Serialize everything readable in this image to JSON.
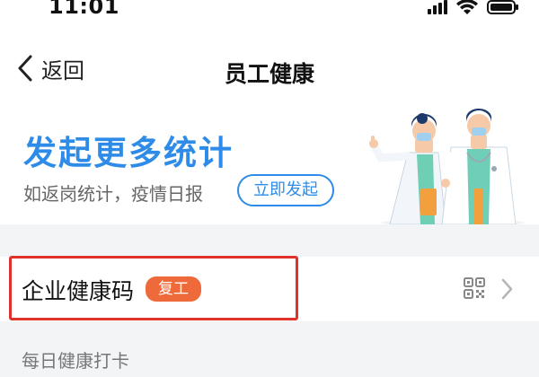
{
  "status_bar": {
    "time": "11:01",
    "icons": [
      "signal-icon",
      "wifi-icon",
      "battery-icon"
    ]
  },
  "nav": {
    "back_label": "返回",
    "title": "员工健康"
  },
  "banner": {
    "title": "发起更多统计",
    "subtitle": "如返岗统计，疫情日报",
    "cta_label": "立即发起",
    "accent_color": "#2e8ce8",
    "illustration": "doctors-illustration"
  },
  "health_code": {
    "label": "企业健康码",
    "badge": "复工",
    "badge_color": "#ee6a3a",
    "highlight_color": "#e0322b",
    "icons": [
      "qr-code-icon",
      "chevron-right-icon"
    ]
  },
  "section": {
    "daily_checkin_label": "每日健康打卡"
  }
}
